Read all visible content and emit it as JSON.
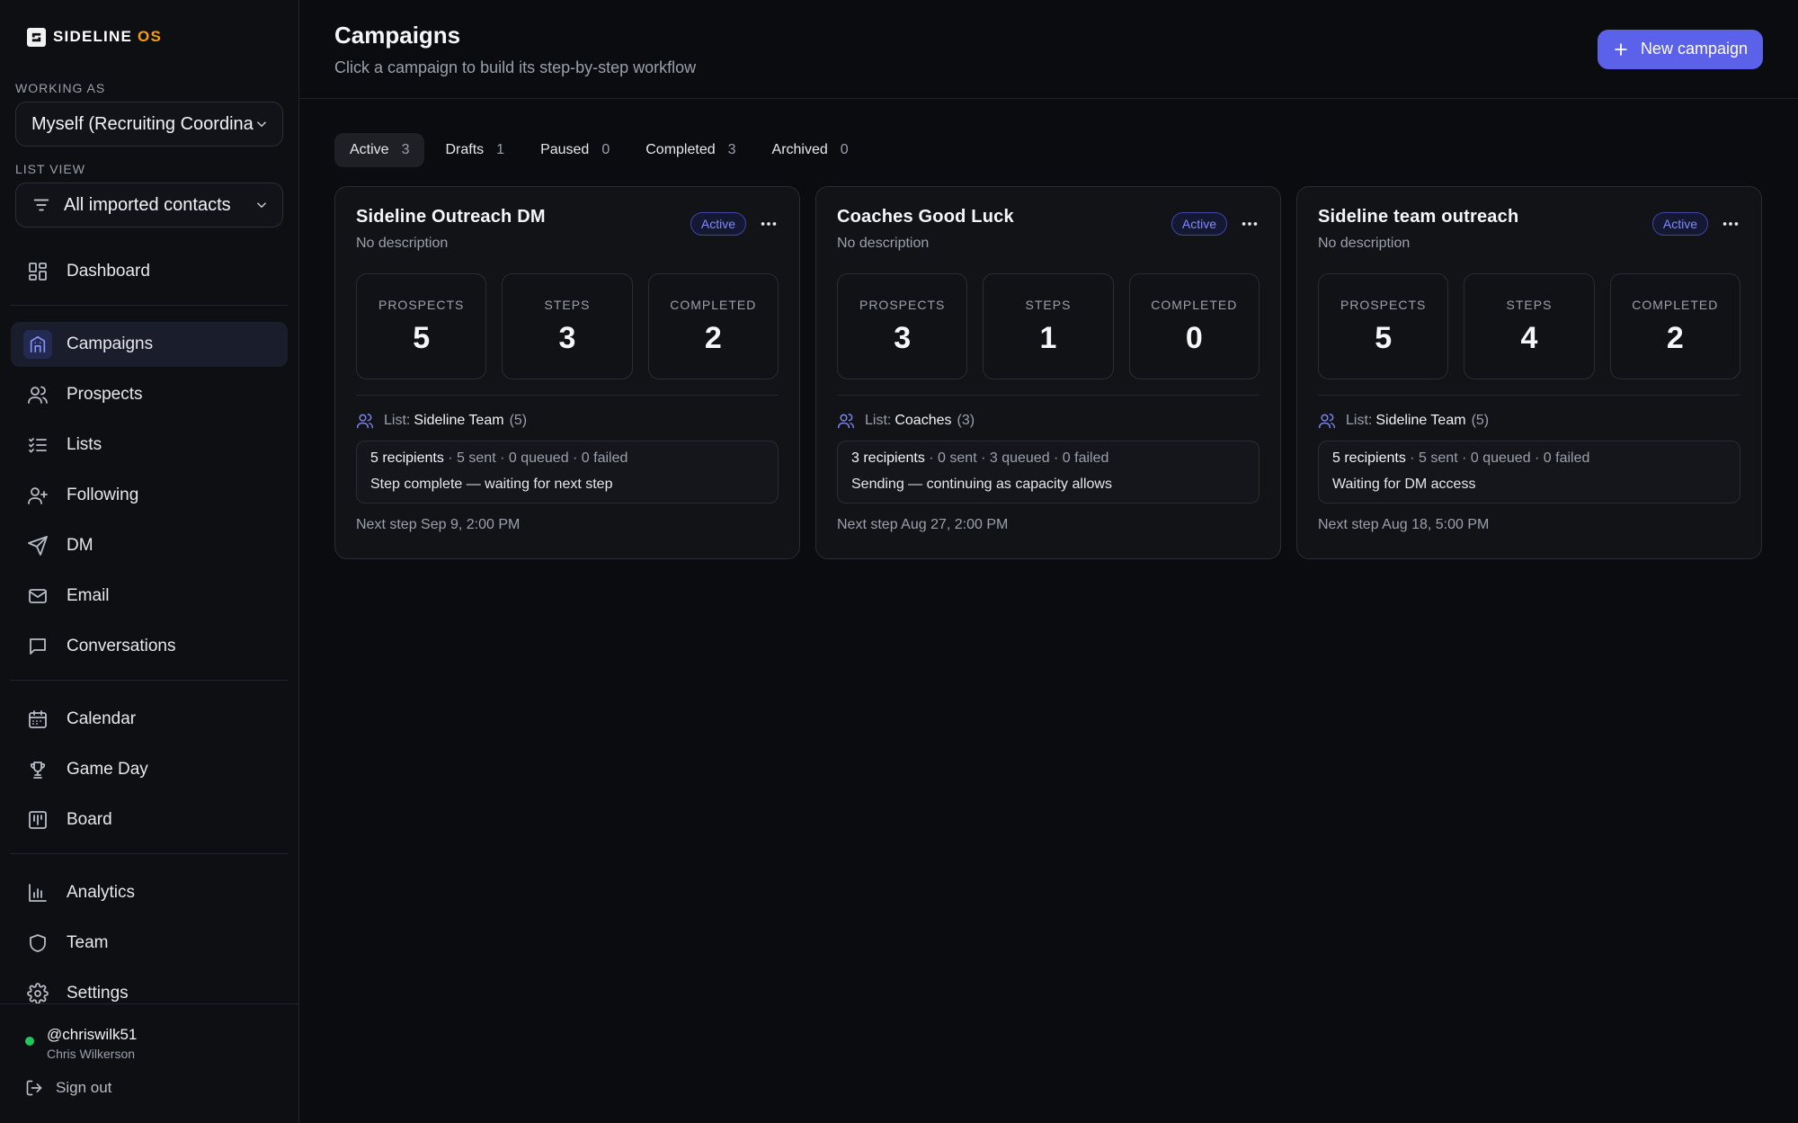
{
  "app": {
    "logo_text": "SIDELINE",
    "logo_accent": "OS"
  },
  "sidebar": {
    "working_as_label": "WORKING AS",
    "working_as_value": "Myself (Recruiting Coordinator)",
    "list_view_label": "LIST VIEW",
    "list_view_value": "All imported contacts",
    "groups": [
      [
        {
          "label": "Dashboard",
          "icon": "dashboard-icon"
        }
      ],
      [
        {
          "label": "Campaigns",
          "icon": "campaigns-icon",
          "active": true
        },
        {
          "label": "Prospects",
          "icon": "prospects-icon"
        },
        {
          "label": "Lists",
          "icon": "lists-icon"
        },
        {
          "label": "Following",
          "icon": "following-icon"
        },
        {
          "label": "DM",
          "icon": "send-icon"
        },
        {
          "label": "Email",
          "icon": "mail-icon"
        },
        {
          "label": "Conversations",
          "icon": "chat-icon"
        }
      ],
      [
        {
          "label": "Calendar",
          "icon": "calendar-icon"
        },
        {
          "label": "Game Day",
          "icon": "trophy-icon"
        },
        {
          "label": "Board",
          "icon": "board-icon"
        }
      ],
      [
        {
          "label": "Analytics",
          "icon": "analytics-icon"
        },
        {
          "label": "Team",
          "icon": "shield-icon"
        },
        {
          "label": "Settings",
          "icon": "gear-icon"
        }
      ]
    ],
    "user": {
      "handle": "@chriswilk51",
      "name": "Chris Wilkerson",
      "sign_out": "Sign out"
    }
  },
  "header": {
    "title": "Campaigns",
    "subtitle": "Click a campaign to build its step-by-step workflow",
    "new_button": "New campaign"
  },
  "tabs": [
    {
      "label": "Active",
      "count": "3",
      "active": true
    },
    {
      "label": "Drafts",
      "count": "1"
    },
    {
      "label": "Paused",
      "count": "0"
    },
    {
      "label": "Completed",
      "count": "3"
    },
    {
      "label": "Archived",
      "count": "0"
    }
  ],
  "stat_labels": {
    "prospects": "PROSPECTS",
    "steps": "STEPS",
    "completed": "COMPLETED"
  },
  "campaigns": [
    {
      "title": "Sideline Outreach DM",
      "description": "No description",
      "status": "Active",
      "prospects": "5",
      "steps": "3",
      "completed": "2",
      "list_prefix": "List:",
      "list_name": "Sideline Team",
      "list_count": "(5)",
      "recipients": "5 recipients",
      "delivery": " · 5 sent · 0 queued · 0 failed",
      "status_message": "Step complete — waiting for next step",
      "next_step": "Next step Sep 9, 2:00 PM"
    },
    {
      "title": "Coaches Good Luck",
      "description": "No description",
      "status": "Active",
      "prospects": "3",
      "steps": "1",
      "completed": "0",
      "list_prefix": "List:",
      "list_name": "Coaches",
      "list_count": "(3)",
      "recipients": "3 recipients",
      "delivery": " · 0 sent · 3 queued · 0 failed",
      "status_message": "Sending — continuing as capacity allows",
      "next_step": "Next step Aug 27, 2:00 PM"
    },
    {
      "title": "Sideline team outreach",
      "description": "No description",
      "status": "Active",
      "prospects": "5",
      "steps": "4",
      "completed": "2",
      "list_prefix": "List:",
      "list_name": "Sideline Team",
      "list_count": "(5)",
      "recipients": "5 recipients",
      "delivery": " · 5 sent · 0 queued · 0 failed",
      "status_message": "Waiting for DM access",
      "next_step": "Next step Aug 18, 5:00 PM"
    }
  ],
  "colors": {
    "accent": "#5b61e8",
    "badge": "#818cf8",
    "online": "#22c55e",
    "logo_accent": "#f59e0b"
  }
}
